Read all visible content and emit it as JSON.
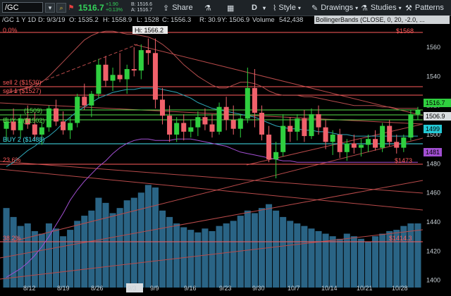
{
  "toolbar": {
    "symbol": "/GC",
    "last_price": "1516.7",
    "change": "+1.90",
    "change_pct": "+0.13%",
    "bid": "B: 1516.6",
    "ask": "A: 1516.7",
    "share_label": "Share",
    "interval_label": "D",
    "style_label": "Style",
    "drawings_label": "Drawings",
    "studies_label": "Studies",
    "patterns_label": "Patterns"
  },
  "infobar": {
    "title": "/GC 1 Y 1D",
    "date": "D: 9/3/19",
    "open": "O: 1535.2",
    "high": "H: 1558.9",
    "low": "L: 1528",
    "close": "C: 1556.3",
    "range": "R: 30.9",
    "y": "Y: 1506.9",
    "volume_label": "Volume",
    "volume": "542,438",
    "study": "BollingerBands (CLOSE, 0, 20, -2.0, ..."
  },
  "chart": {
    "hi_label": "Hi: 1566.2",
    "top_left_pct": "0.0%",
    "fib_236": "23.6%",
    "fib_382": "38.2%",
    "levels": [
      {
        "label": "sell 2 ($1530)",
        "color": "#ff5b5b"
      },
      {
        "label": "sell 1 ($1527)",
        "color": "#ff5b5b"
      },
      {
        "label": "BUY 1 ($1502)",
        "color": "#57e04a"
      },
      {
        "label": "BUY 2 ($1488)",
        "color": "#43e3ef"
      },
      {
        "label": "(1509)",
        "color": "#57e04a"
      }
    ],
    "right_labels": {
      "top": "$1568",
      "p1516": "1516.7",
      "p1506": "1506.9",
      "p1499": "1499",
      "p1481": "1481",
      "p1473": "$1473",
      "p1414": "$1414.3"
    },
    "y_ticks": [
      "1560",
      "1540",
      "1520",
      "1500",
      "1480",
      "1460",
      "1440",
      "1420",
      "1400"
    ],
    "x_ticks": [
      "8/12",
      "8/19",
      "8/26",
      "9/3",
      "9/9",
      "9/16",
      "9/23",
      "9/30",
      "10/7",
      "10/14",
      "10/21",
      "10/28"
    ],
    "colors": {
      "up": "#2fcf3f",
      "down": "#f0616b",
      "volume": "#2f6f93",
      "bg": "#000000"
    }
  },
  "chart_data": {
    "type": "candlestick",
    "y_range": [
      1395,
      1575
    ],
    "candles": [
      {
        "o": 1504,
        "h": 1512,
        "l": 1495,
        "c": 1509
      },
      {
        "o": 1509,
        "h": 1518,
        "l": 1500,
        "c": 1503
      },
      {
        "o": 1503,
        "h": 1514,
        "l": 1498,
        "c": 1511
      },
      {
        "o": 1511,
        "h": 1520,
        "l": 1504,
        "c": 1507
      },
      {
        "o": 1507,
        "h": 1515,
        "l": 1496,
        "c": 1500
      },
      {
        "o": 1500,
        "h": 1509,
        "l": 1493,
        "c": 1505
      },
      {
        "o": 1505,
        "h": 1520,
        "l": 1502,
        "c": 1518
      },
      {
        "o": 1518,
        "h": 1524,
        "l": 1506,
        "c": 1509
      },
      {
        "o": 1509,
        "h": 1516,
        "l": 1500,
        "c": 1503
      },
      {
        "o": 1503,
        "h": 1512,
        "l": 1497,
        "c": 1508
      },
      {
        "o": 1508,
        "h": 1528,
        "l": 1505,
        "c": 1526
      },
      {
        "o": 1526,
        "h": 1535,
        "l": 1517,
        "c": 1520
      },
      {
        "o": 1520,
        "h": 1530,
        "l": 1512,
        "c": 1528
      },
      {
        "o": 1528,
        "h": 1552,
        "l": 1525,
        "c": 1548
      },
      {
        "o": 1548,
        "h": 1554,
        "l": 1533,
        "c": 1537
      },
      {
        "o": 1537,
        "h": 1546,
        "l": 1530,
        "c": 1541
      },
      {
        "o": 1541,
        "h": 1556,
        "l": 1536,
        "c": 1538
      },
      {
        "o": 1538,
        "h": 1548,
        "l": 1528,
        "c": 1545
      },
      {
        "o": 1545,
        "h": 1560,
        "l": 1540,
        "c": 1544
      },
      {
        "o": 1544,
        "h": 1562,
        "l": 1538,
        "c": 1558
      },
      {
        "o": 1558,
        "h": 1566,
        "l": 1548,
        "c": 1556
      },
      {
        "o": 1556,
        "h": 1566,
        "l": 1518,
        "c": 1524
      },
      {
        "o": 1524,
        "h": 1532,
        "l": 1507,
        "c": 1513
      },
      {
        "o": 1513,
        "h": 1520,
        "l": 1495,
        "c": 1500
      },
      {
        "o": 1500,
        "h": 1512,
        "l": 1495,
        "c": 1508
      },
      {
        "o": 1508,
        "h": 1514,
        "l": 1496,
        "c": 1502
      },
      {
        "o": 1502,
        "h": 1510,
        "l": 1498,
        "c": 1505
      },
      {
        "o": 1505,
        "h": 1516,
        "l": 1499,
        "c": 1512
      },
      {
        "o": 1512,
        "h": 1518,
        "l": 1503,
        "c": 1507
      },
      {
        "o": 1507,
        "h": 1514,
        "l": 1498,
        "c": 1502
      },
      {
        "o": 1502,
        "h": 1522,
        "l": 1500,
        "c": 1519
      },
      {
        "o": 1519,
        "h": 1526,
        "l": 1503,
        "c": 1510
      },
      {
        "o": 1510,
        "h": 1520,
        "l": 1500,
        "c": 1504
      },
      {
        "o": 1504,
        "h": 1514,
        "l": 1498,
        "c": 1511
      },
      {
        "o": 1511,
        "h": 1546,
        "l": 1508,
        "c": 1532
      },
      {
        "o": 1532,
        "h": 1545,
        "l": 1505,
        "c": 1515
      },
      {
        "o": 1515,
        "h": 1520,
        "l": 1496,
        "c": 1500
      },
      {
        "o": 1500,
        "h": 1506,
        "l": 1481,
        "c": 1483
      },
      {
        "o": 1483,
        "h": 1495,
        "l": 1470,
        "c": 1488
      },
      {
        "o": 1488,
        "h": 1514,
        "l": 1485,
        "c": 1506
      },
      {
        "o": 1506,
        "h": 1512,
        "l": 1495,
        "c": 1502
      },
      {
        "o": 1502,
        "h": 1514,
        "l": 1496,
        "c": 1511
      },
      {
        "o": 1511,
        "h": 1517,
        "l": 1495,
        "c": 1499
      },
      {
        "o": 1499,
        "h": 1518,
        "l": 1497,
        "c": 1514
      },
      {
        "o": 1514,
        "h": 1520,
        "l": 1500,
        "c": 1505
      },
      {
        "o": 1505,
        "h": 1510,
        "l": 1490,
        "c": 1495
      },
      {
        "o": 1495,
        "h": 1503,
        "l": 1486,
        "c": 1500
      },
      {
        "o": 1500,
        "h": 1504,
        "l": 1484,
        "c": 1488
      },
      {
        "o": 1488,
        "h": 1497,
        "l": 1482,
        "c": 1494
      },
      {
        "o": 1494,
        "h": 1500,
        "l": 1487,
        "c": 1491
      },
      {
        "o": 1491,
        "h": 1497,
        "l": 1485,
        "c": 1493
      },
      {
        "o": 1493,
        "h": 1500,
        "l": 1488,
        "c": 1497
      },
      {
        "o": 1497,
        "h": 1503,
        "l": 1489,
        "c": 1491
      },
      {
        "o": 1491,
        "h": 1508,
        "l": 1488,
        "c": 1506
      },
      {
        "o": 1506,
        "h": 1510,
        "l": 1492,
        "c": 1495
      },
      {
        "o": 1495,
        "h": 1500,
        "l": 1487,
        "c": 1491
      },
      {
        "o": 1491,
        "h": 1500,
        "l": 1488,
        "c": 1498
      },
      {
        "o": 1498,
        "h": 1517,
        "l": 1496,
        "c": 1514
      },
      {
        "o": 1514,
        "h": 1519,
        "l": 1510,
        "c": 1516.7
      }
    ],
    "volume": [
      0.62,
      0.55,
      0.48,
      0.5,
      0.44,
      0.42,
      0.5,
      0.46,
      0.4,
      0.45,
      0.52,
      0.56,
      0.6,
      0.7,
      0.66,
      0.58,
      0.62,
      0.68,
      0.7,
      0.74,
      0.8,
      0.78,
      0.6,
      0.55,
      0.5,
      0.47,
      0.45,
      0.43,
      0.46,
      0.44,
      0.48,
      0.5,
      0.52,
      0.56,
      0.6,
      0.58,
      0.62,
      0.65,
      0.6,
      0.55,
      0.52,
      0.5,
      0.48,
      0.46,
      0.44,
      0.42,
      0.4,
      0.38,
      0.42,
      0.4,
      0.38,
      0.36,
      0.4,
      0.42,
      0.44,
      0.45,
      0.48,
      0.5,
      0.5
    ],
    "bb_upper": [
      1528,
      1530,
      1531,
      1532,
      1533,
      1536,
      1540,
      1545,
      1550,
      1555,
      1560,
      1565,
      1568,
      1570,
      1571,
      1571,
      1570,
      1569,
      1569,
      1568,
      1567,
      1565,
      1562,
      1558,
      1553,
      1548,
      1544,
      1540,
      1537,
      1534,
      1532,
      1532,
      1534,
      1536,
      1536,
      1535,
      1533,
      1530,
      1528,
      1527,
      1527,
      1527,
      1526,
      1526,
      1525,
      1524,
      1523,
      1522,
      1521,
      1520,
      1520,
      1520,
      1520,
      1519,
      1519,
      1518,
      1518,
      1518,
      1518
    ],
    "bb_mid": [
      1478,
      1481,
      1485,
      1489,
      1492,
      1496,
      1499,
      1503,
      1508,
      1512,
      1516,
      1519,
      1522,
      1525,
      1527,
      1529,
      1530,
      1531,
      1531,
      1532,
      1532,
      1532,
      1531,
      1530,
      1529,
      1527,
      1525,
      1522,
      1520,
      1518,
      1517,
      1516,
      1515,
      1514,
      1513,
      1512,
      1510,
      1508,
      1506,
      1505,
      1504,
      1504,
      1503,
      1503,
      1502,
      1502,
      1501,
      1500,
      1500,
      1499,
      1499,
      1499,
      1499,
      1499,
      1499,
      1499,
      1499,
      1499,
      1499
    ],
    "bb_lower": [
      1402,
      1405,
      1408,
      1412,
      1417,
      1423,
      1430,
      1438,
      1446,
      1455,
      1462,
      1468,
      1473,
      1478,
      1482,
      1487,
      1491,
      1494,
      1496,
      1497,
      1497,
      1496,
      1496,
      1496,
      1497,
      1497,
      1497,
      1496,
      1495,
      1494,
      1493,
      1492,
      1490,
      1488,
      1487,
      1486,
      1485,
      1484,
      1483,
      1482,
      1482,
      1481,
      1481,
      1481,
      1481,
      1481,
      1481,
      1481,
      1481,
      1481,
      1481,
      1481,
      1481,
      1481,
      1481,
      1481,
      1481,
      1481,
      1481
    ]
  }
}
